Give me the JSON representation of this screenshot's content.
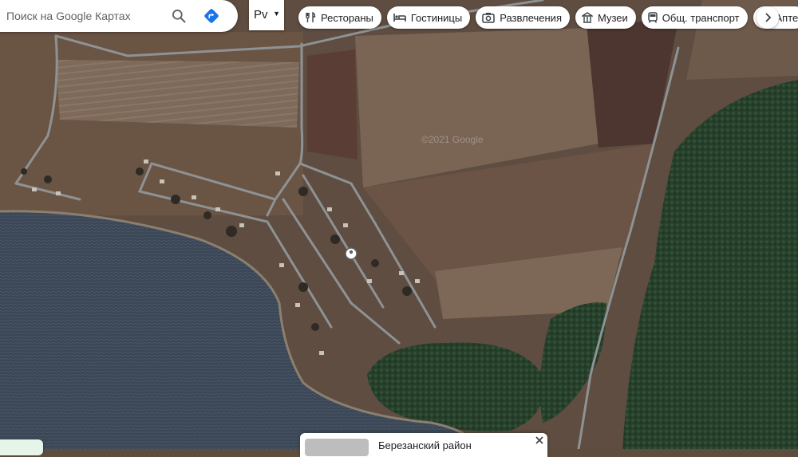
{
  "search": {
    "placeholder": "Поиск на Google Картах"
  },
  "layer_button": {
    "label": "Рv"
  },
  "chips": [
    {
      "label": "Рестораны",
      "icon": "fork-knife-icon"
    },
    {
      "label": "Гостиницы",
      "icon": "bed-icon"
    },
    {
      "label": "Развлечения",
      "icon": "camera-icon"
    },
    {
      "label": "Музеи",
      "icon": "museum-icon"
    },
    {
      "label": "Общ. транспорт",
      "icon": "train-icon"
    },
    {
      "label": "Апте",
      "icon": "pharmacy-icon"
    }
  ],
  "map": {
    "watermark": "©2021 Google"
  },
  "place_card": {
    "title": "Березанский район"
  },
  "colors": {
    "direction_blue": "#1a73e8",
    "water": "#3a4655",
    "forest": "#26402a",
    "field": "#6f5a48"
  }
}
